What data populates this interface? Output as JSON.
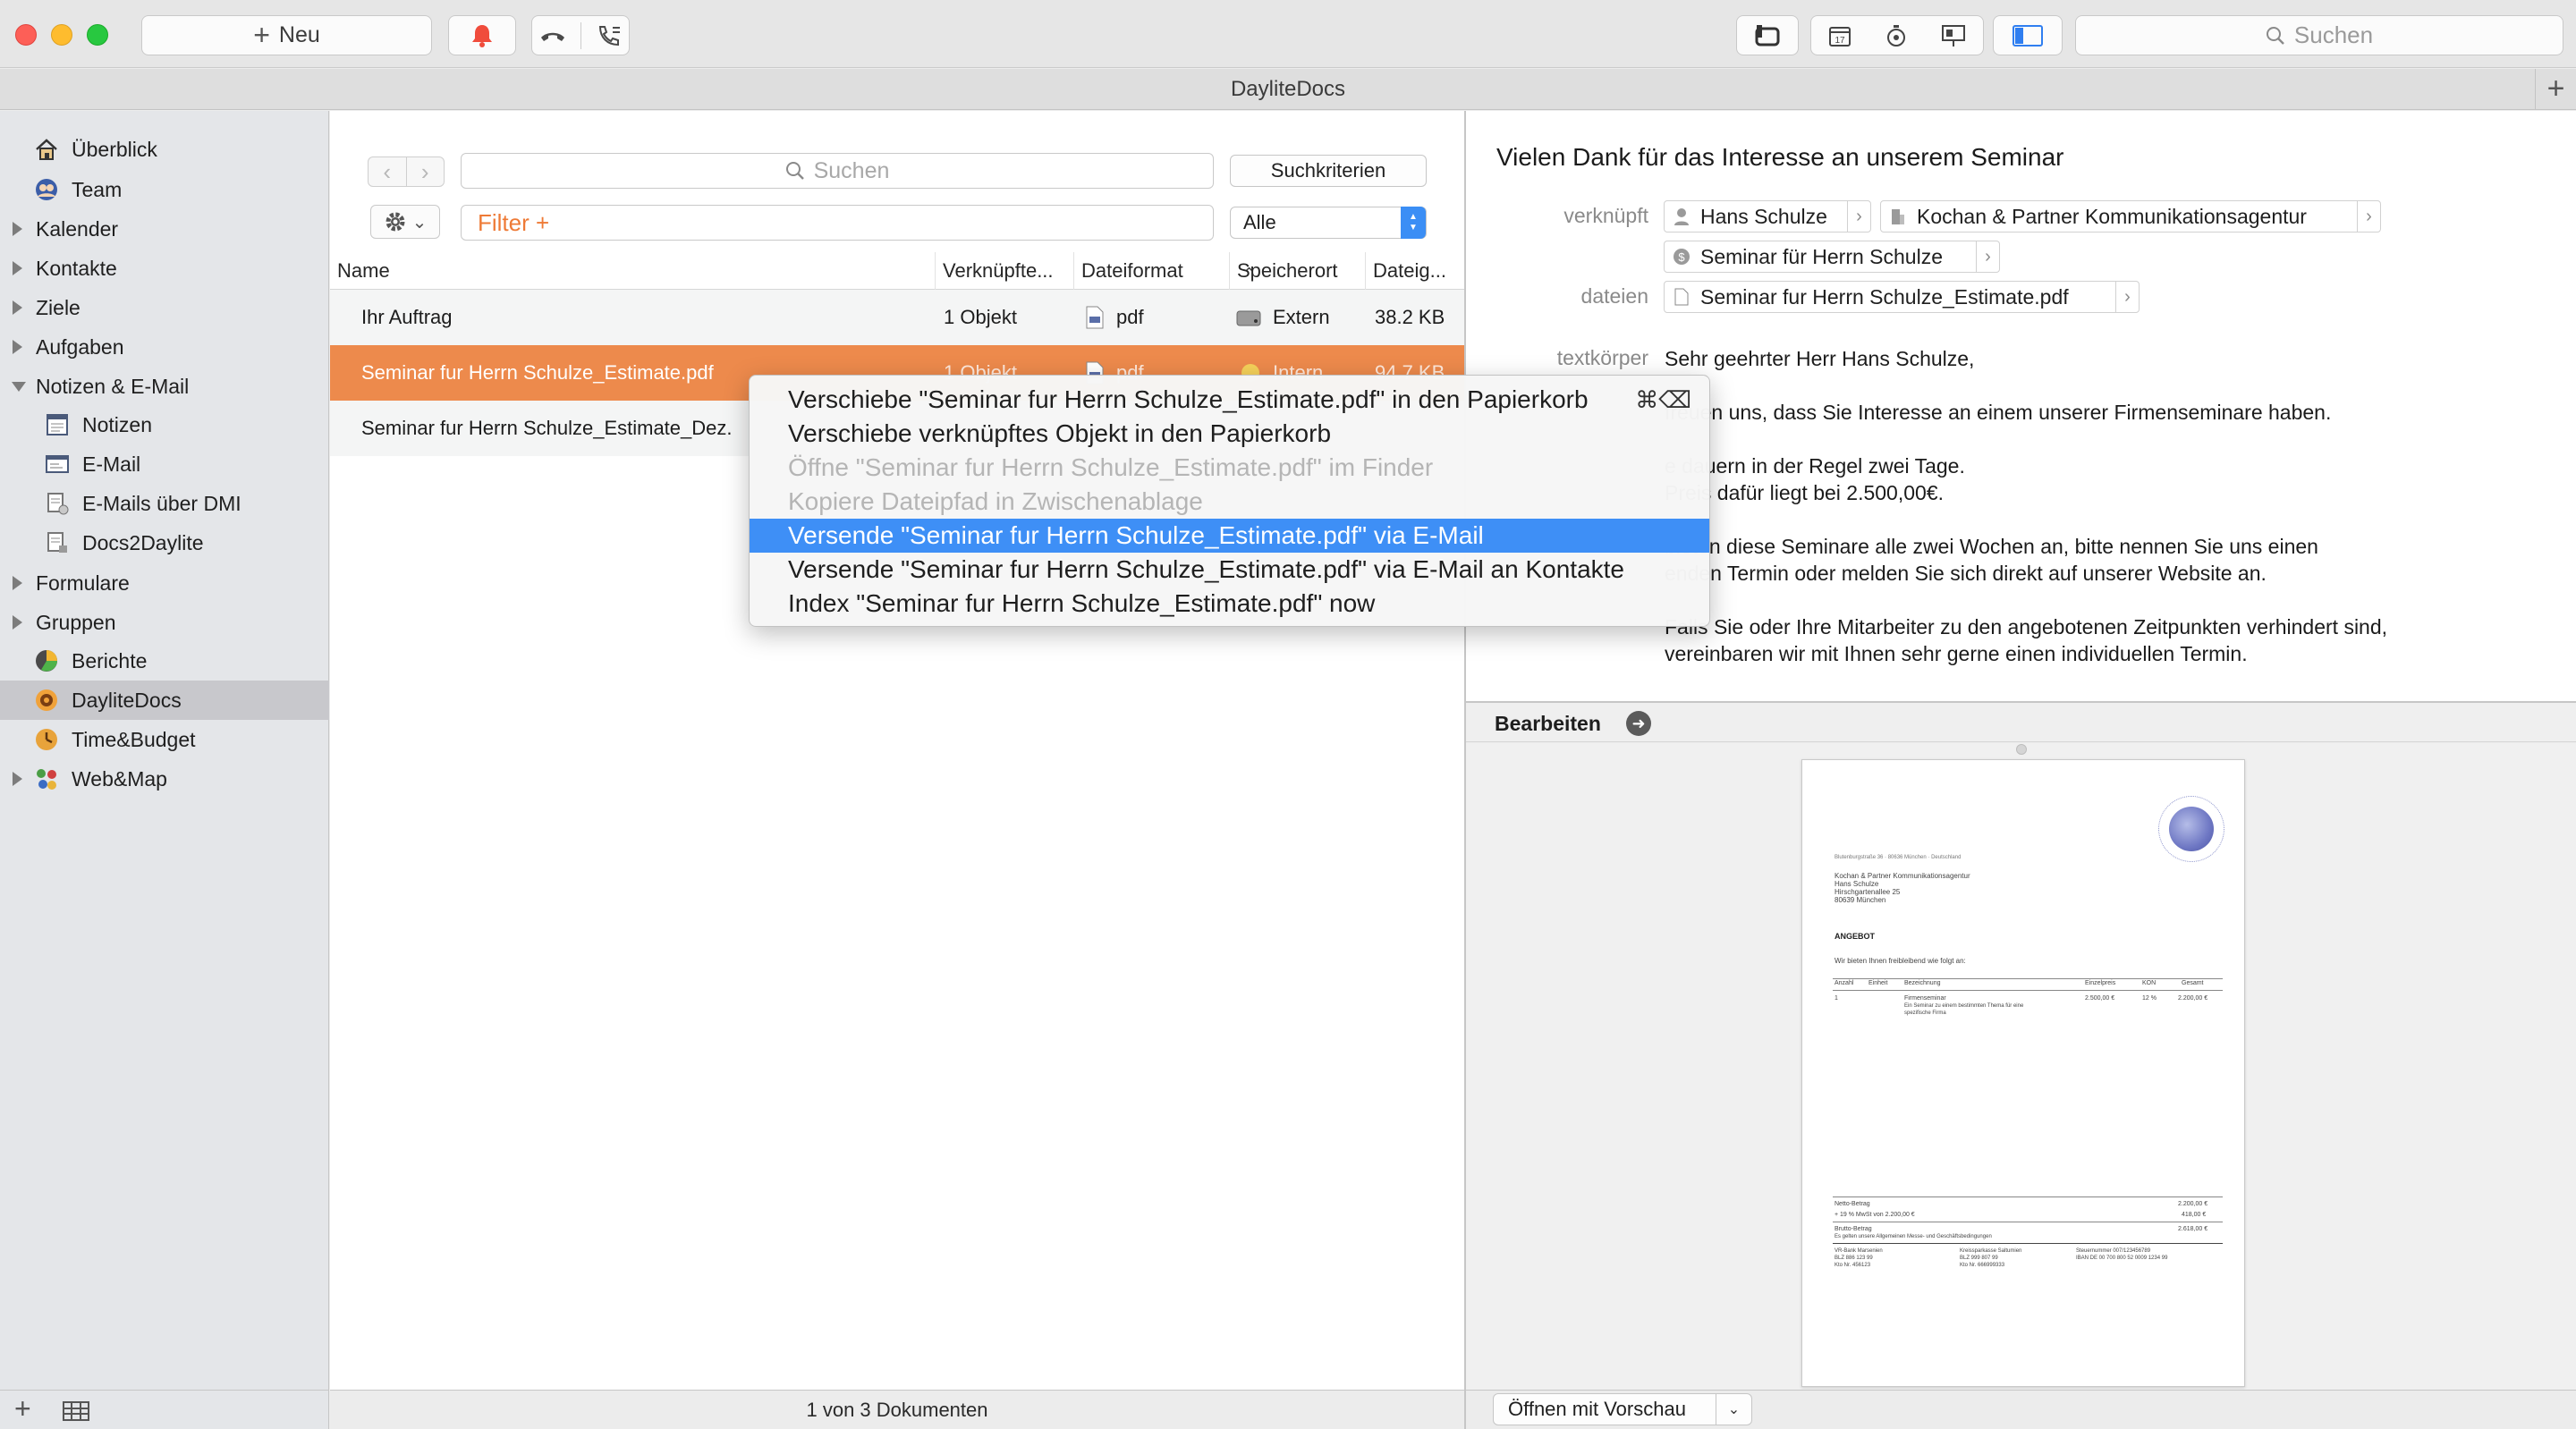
{
  "toolbar": {
    "new_label": "Neu",
    "search_placeholder": "Suchen",
    "icons": [
      "bell-icon",
      "hangup-icon",
      "phone-list-icon",
      "daylite-link-icon",
      "calendar-icon",
      "timer-icon",
      "presentation-icon",
      "sidebar-toggle-icon"
    ],
    "calendar_day": "17"
  },
  "tabbar": {
    "title": "DayliteDocs",
    "plus": "+"
  },
  "sidebar": {
    "items": [
      {
        "label": "Überblick",
        "icon": "home-icon"
      },
      {
        "label": "Team",
        "icon": "team-icon"
      },
      {
        "label": "Kalender",
        "toggle": "closed"
      },
      {
        "label": "Kontakte",
        "toggle": "closed"
      },
      {
        "label": "Ziele",
        "toggle": "closed"
      },
      {
        "label": "Aufgaben",
        "toggle": "closed"
      },
      {
        "label": "Notizen & E-Mail",
        "toggle": "open"
      },
      {
        "label": "Notizen",
        "icon": "notes-icon"
      },
      {
        "label": "E-Mail",
        "icon": "email-icon"
      },
      {
        "label": "E-Mails über DMI",
        "icon": "dmi-icon"
      },
      {
        "label": "Docs2Daylite",
        "icon": "docs-icon"
      },
      {
        "label": "Formulare",
        "toggle": "closed"
      },
      {
        "label": "Gruppen",
        "toggle": "closed"
      },
      {
        "label": "Berichte",
        "icon": "reports-icon"
      },
      {
        "label": "DayliteDocs",
        "icon": "daylitedocs-icon",
        "selected": true
      },
      {
        "label": "Time&Budget",
        "icon": "timebudget-icon"
      },
      {
        "label": "Web&Map",
        "icon": "webmap-icon",
        "toggle": "closed"
      }
    ]
  },
  "list": {
    "search_placeholder": "Suchen",
    "criteria_button": "Suchkriterien",
    "filter_placeholder": "Filter +",
    "scope_select": "Alle",
    "columns": [
      "Name",
      "Verknüpfte...",
      "Dateiformat",
      "Speicherort",
      "Dateig..."
    ],
    "rows": [
      {
        "name": "Ihr Auftrag",
        "linked": "1 Objekt",
        "format": "pdf",
        "location": "Extern",
        "size": "38.2 KB"
      },
      {
        "name": "Seminar fur Herrn Schulze_Estimate.pdf",
        "linked": "1 Objekt",
        "format": "pdf",
        "location": "Intern",
        "size": "94.7 KB"
      },
      {
        "name": "Seminar fur Herrn Schulze_Estimate_Dez.",
        "linked": "",
        "format": "",
        "location": "",
        "size": ""
      }
    ],
    "status": "1 von 3 Dokumenten"
  },
  "context_menu": {
    "items": [
      {
        "label": "Verschiebe \"Seminar fur Herrn Schulze_Estimate.pdf\" in den Papierkorb",
        "shortcut": "⌘⌫",
        "state": "normal"
      },
      {
        "label": "Verschiebe verknüpftes Objekt in den Papierkorb",
        "state": "normal"
      },
      {
        "label": "Öffne \"Seminar fur Herrn Schulze_Estimate.pdf\" im Finder",
        "state": "disabled"
      },
      {
        "label": "Kopiere Dateipfad in Zwischenablage",
        "state": "disabled"
      },
      {
        "label": "Versende \"Seminar fur Herrn Schulze_Estimate.pdf\" via E-Mail",
        "state": "highlighted"
      },
      {
        "label": "Versende \"Seminar fur Herrn Schulze_Estimate.pdf\" via E-Mail an Kontakte",
        "state": "normal"
      },
      {
        "label": "Index \"Seminar fur Herrn Schulze_Estimate.pdf\" now",
        "state": "normal"
      }
    ]
  },
  "detail": {
    "title": "Vielen Dank für das Interesse an unserem Seminar",
    "linked_label": "verknüpft",
    "files_label": "dateien",
    "body_label": "textkörper",
    "linked_chips": [
      "Hans Schulze",
      "Kochan & Partner Kommunikationsagentur",
      "Seminar für Herrn Schulze"
    ],
    "file_chip": "Seminar fur Herrn Schulze_Estimate.pdf",
    "body_lines": [
      "Sehr geehrter Herr Hans Schulze,",
      "",
      "freuen uns, dass Sie Interesse an einem unserer Firmenseminare haben.",
      "",
      "e dauern in der Regel zwei Tage.",
      "Preis dafür liegt bei 2.500,00€.",
      "",
      "bieten diese Seminare alle zwei Wochen an, bitte nennen Sie uns einen",
      "enden Termin oder melden Sie sich direkt auf unserer Website an.",
      "",
      "Falls Sie oder Ihre Mitarbeiter zu den angebotenen Zeitpunkten verhindert sind,",
      "vereinbaren wir mit Ihnen sehr gerne einen individuellen Termin."
    ],
    "edit_label": "Bearbeiten",
    "open_button": "Öffnen mit Vorschau"
  },
  "pdf": {
    "sender_line": "Blutenburgstraße 36 · 80636 München · Deutschland",
    "recipient": [
      "Kochan & Partner Kommunikationsagentur",
      "Hans Schulze",
      "Hirschgartenallee 25",
      "80639 München"
    ],
    "heading": "ANGEBOT",
    "intro": "Wir bieten Ihnen freibleibend wie folgt an:",
    "table_headers": [
      "Anzahl",
      "Einheit",
      "Bezeichnung",
      "Einzelpreis",
      "KON",
      "Gesamt"
    ],
    "item": {
      "qty": "1",
      "name": "Firmenseminar",
      "desc1": "Ein Seminar zu einem bestimmten Thema für eine",
      "desc2": "spezifische Firma",
      "price": "2.500,00 €",
      "discount": "12 %",
      "total": "2.200,00 €"
    },
    "netto_label": "Netto-Betrag",
    "netto": "2.200,00 €",
    "tax_label": "+ 19 % MwSt von 2.200,00 €",
    "tax": "418,00 €",
    "brutto_label": "Brutto-Betrag",
    "brutto": "2.618,00 €",
    "terms": "Es gelten unsere Allgemeinen Messe- und Geschäftsbedingungen",
    "footer": [
      [
        "VR-Bank Marsenien",
        "BLZ 886 123 99",
        "Kto Nr. 456123"
      ],
      [
        "Kreissparkasse Saltumien",
        "BLZ 999 807 99",
        "Kto Nr. 666999333"
      ],
      [
        "Steuernummer 007/123456789",
        "IBAN DE 00 700 800 52 0009 1234 99",
        ""
      ]
    ]
  },
  "colors": {
    "selection_orange": "#ed8a4c",
    "menu_highlight": "#3e8ff6",
    "filter_text": "#ee7a36"
  }
}
